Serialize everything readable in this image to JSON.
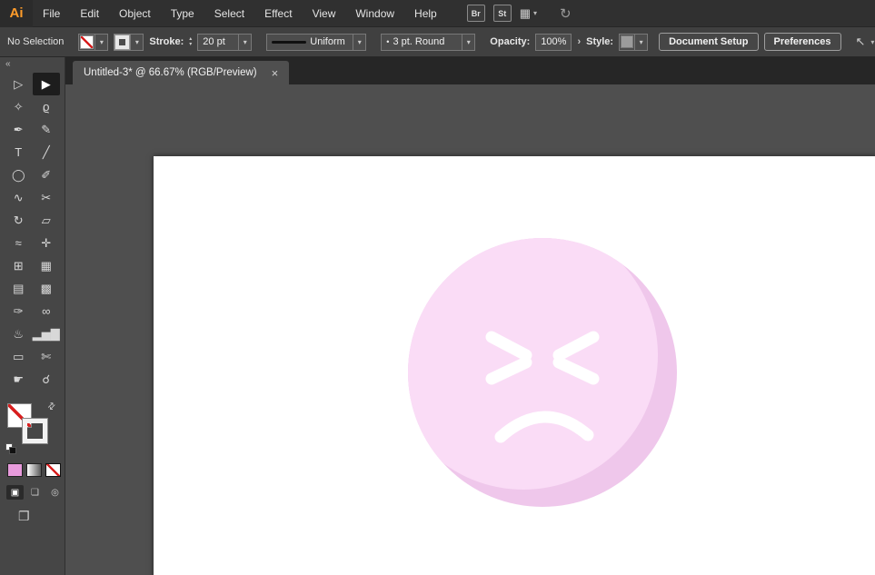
{
  "menu_bar": {
    "logo": "Ai",
    "items": [
      "File",
      "Edit",
      "Object",
      "Type",
      "Select",
      "Effect",
      "View",
      "Window",
      "Help"
    ],
    "bridge_label": "Br",
    "stock_label": "St"
  },
  "control_bar": {
    "selection_status": "No Selection",
    "stroke_label": "Stroke:",
    "stroke_weight": "20 pt",
    "profile_label": "Uniform",
    "brush_label": "3 pt. Round",
    "opacity_label": "Opacity:",
    "opacity_value": "100%",
    "style_label": "Style:",
    "document_setup_label": "Document Setup",
    "preferences_label": "Preferences"
  },
  "document_tab": {
    "title": "Untitled-3* @ 66.67% (RGB/Preview)"
  },
  "icons": {
    "chevron_down": "▾",
    "submenu_arrow": "›",
    "stepper_up": "▴",
    "stepper_down": "▾",
    "close": "×",
    "collapse": "«",
    "swap": "⇄",
    "bullet": "•",
    "workspace_grid": "▦",
    "sync": "↻",
    "pointer": "↖",
    "screen_mode": "❐",
    "draw_normal": "▣",
    "draw_behind": "❏",
    "draw_inside": "◎"
  },
  "toolbar": {
    "tools": [
      {
        "name": "selection-tool",
        "glyph": "▷"
      },
      {
        "name": "direct-selection-tool",
        "glyph": "▶",
        "selected": true
      },
      {
        "name": "magic-wand-tool",
        "glyph": "✧"
      },
      {
        "name": "lasso-tool",
        "glyph": "ϱ"
      },
      {
        "name": "pen-tool",
        "glyph": "✒"
      },
      {
        "name": "curvature-tool",
        "glyph": "✎"
      },
      {
        "name": "type-tool",
        "glyph": "T"
      },
      {
        "name": "line-segment-tool",
        "glyph": "╱"
      },
      {
        "name": "ellipse-tool",
        "glyph": "◯"
      },
      {
        "name": "paintbrush-tool",
        "glyph": "✐"
      },
      {
        "name": "shaper-tool",
        "glyph": "∿"
      },
      {
        "name": "scissors-tool",
        "glyph": "✂"
      },
      {
        "name": "rotate-tool",
        "glyph": "↻"
      },
      {
        "name": "scale-tool",
        "glyph": "▱"
      },
      {
        "name": "width-tool",
        "glyph": "≈"
      },
      {
        "name": "free-transform-tool",
        "glyph": "✛"
      },
      {
        "name": "shape-builder-tool",
        "glyph": "⊞"
      },
      {
        "name": "perspective-grid-tool",
        "glyph": "▦"
      },
      {
        "name": "mesh-tool",
        "glyph": "▤"
      },
      {
        "name": "gradient-tool",
        "glyph": "▩"
      },
      {
        "name": "eyedropper-tool",
        "glyph": "✑"
      },
      {
        "name": "blend-tool",
        "glyph": "∞"
      },
      {
        "name": "symbol-sprayer-tool",
        "glyph": "♨"
      },
      {
        "name": "column-graph-tool",
        "glyph": "▂▅▇"
      },
      {
        "name": "artboard-tool",
        "glyph": "▭"
      },
      {
        "name": "slice-tool",
        "glyph": "✄"
      },
      {
        "name": "hand-tool",
        "glyph": "☛"
      },
      {
        "name": "zoom-tool",
        "glyph": "☌"
      }
    ]
  },
  "swatches": {
    "current_color": "#e89bdc",
    "color_button_style": "background:#e89bdc"
  },
  "artwork": {
    "face_color": "#fadcf6",
    "shadow_color": "#efc7eb",
    "feature_color": "#ffffff"
  }
}
